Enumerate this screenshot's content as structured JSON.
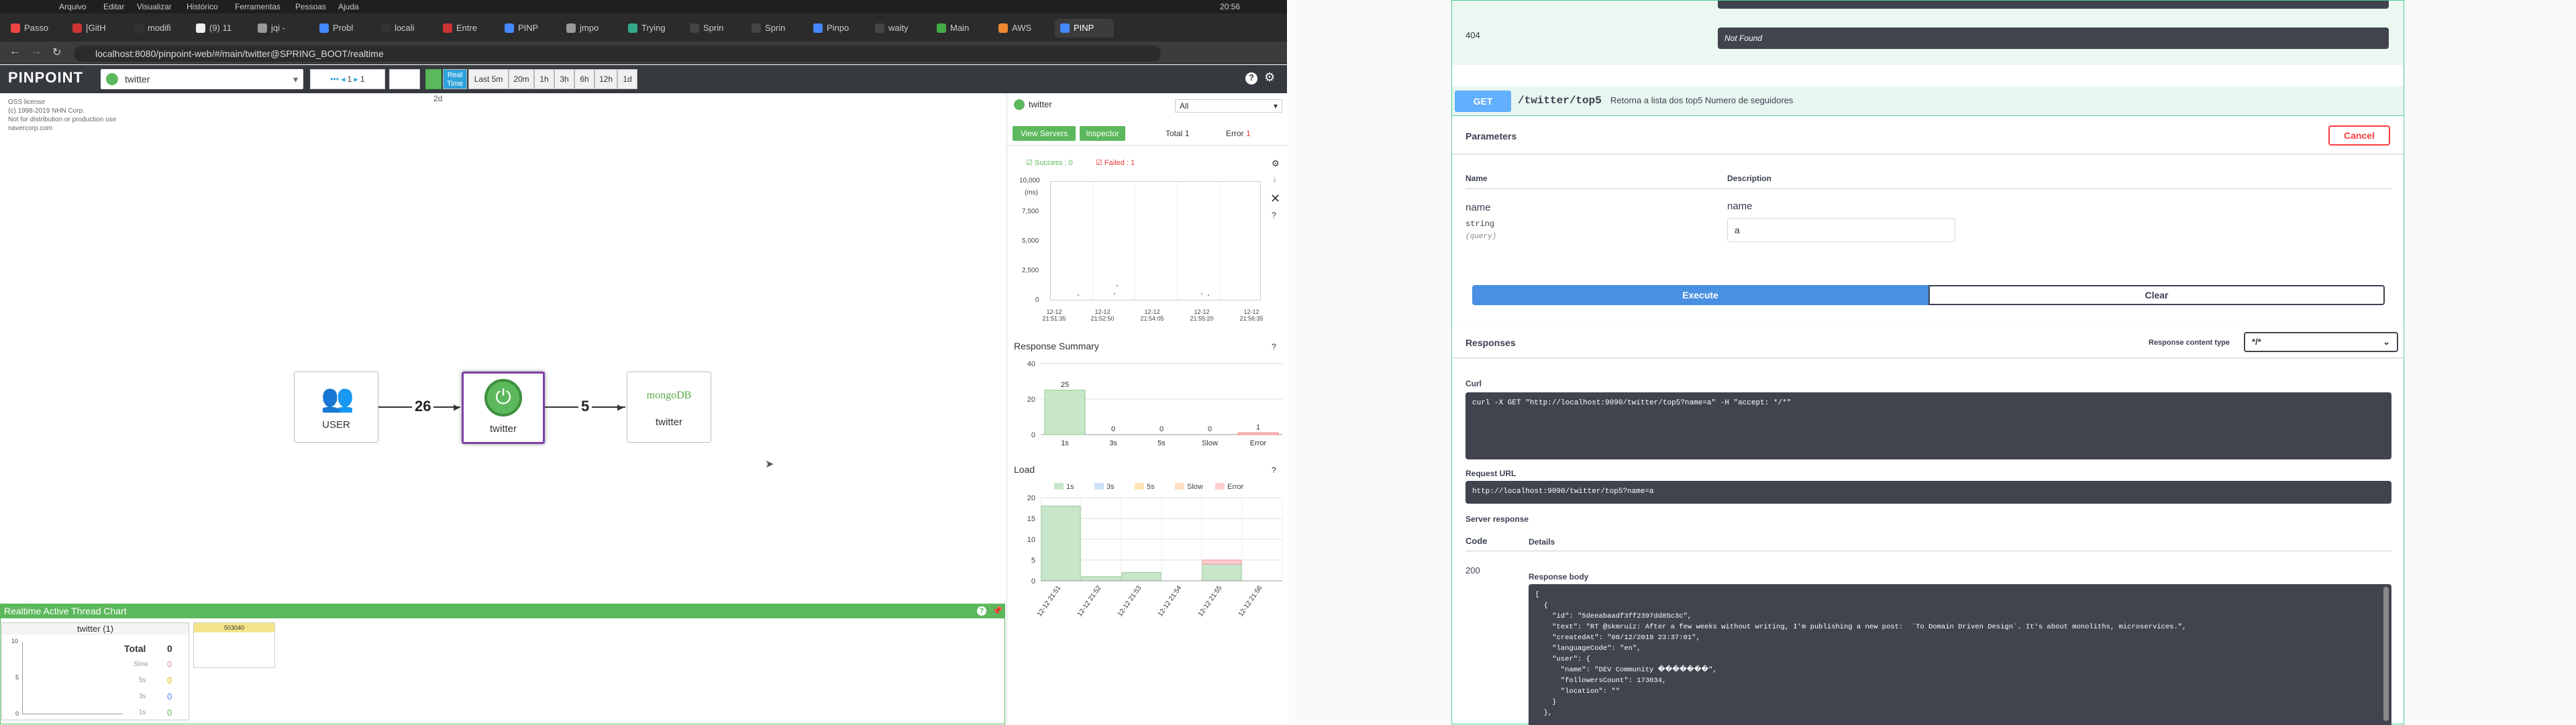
{
  "os": {
    "menu": [
      "Arquivo",
      "Editar",
      "Visualizar",
      "Histórico",
      "Ferramentas",
      "Pessoas",
      "Ajuda"
    ],
    "clock": "20:56"
  },
  "tabs": [
    {
      "label": "Passo",
      "color": "#e44"
    },
    {
      "label": "[GitH",
      "color": "#c33"
    },
    {
      "label": "modifi",
      "color": "#333"
    },
    {
      "label": "(9) 11",
      "color": "#eee"
    },
    {
      "label": "jqi -",
      "color": "#999"
    },
    {
      "label": "Probl",
      "color": "#48f"
    },
    {
      "label": "locali",
      "color": "#333"
    },
    {
      "label": "Entre",
      "color": "#c33"
    },
    {
      "label": "PINP",
      "color": "#48f"
    },
    {
      "label": "jmpo",
      "color": "#999"
    },
    {
      "label": "Trying",
      "color": "#3a8"
    },
    {
      "label": "Sprin",
      "color": "#444"
    },
    {
      "label": "Sprin",
      "color": "#444"
    },
    {
      "label": "Pinpo",
      "color": "#48f"
    },
    {
      "label": "waity",
      "color": "#444"
    },
    {
      "label": "Main",
      "color": "#4a4"
    },
    {
      "label": "AWS",
      "color": "#e83"
    },
    {
      "label": "PINP",
      "color": "#48f",
      "active": true
    }
  ],
  "address": "localhost:8080/pinpoint-web/#/main/twitter@SPRING_BOOT/realtime",
  "header": {
    "logo": "PINPOINT",
    "app": "twitter",
    "arrows1": "1",
    "arrows2": "1",
    "realtime": "Real Time",
    "times": [
      "Last 5m",
      "20m",
      "1h",
      "3h",
      "6h",
      "12h",
      "1d"
    ],
    "sub": "2d"
  },
  "license": [
    "OSS license",
    "(c) 1998-2019 NHN Corp.",
    "Not for distribution or production use",
    "navercorp.com"
  ],
  "servermap": {
    "user": "USER",
    "app": "twitter",
    "db": "twitter",
    "db_logo": "mongoDB",
    "edge1": "26",
    "edge2": "5"
  },
  "rt": {
    "title": "Realtime Active Thread Chart",
    "card": "twitter (1)",
    "total_label": "Total",
    "total": "0",
    "rows": [
      {
        "l": "Slow",
        "v": "0",
        "c": "#e8a"
      },
      {
        "l": "5s",
        "v": "0",
        "c": "#fc0"
      },
      {
        "l": "3s",
        "v": "0",
        "c": "#48f"
      },
      {
        "l": "1s",
        "v": "0",
        "c": "#5b5"
      }
    ],
    "y": [
      "10",
      "5",
      "0"
    ],
    "agent": "503040"
  },
  "info": {
    "app": "twitter",
    "select": "All",
    "view_servers": "View Servers",
    "inspector": "Inspector",
    "total_label": "Total",
    "total": "1",
    "error_label": "Error",
    "error": "1",
    "success": "Success : 0",
    "failed": "Failed : 1",
    "scatter_y": [
      "10,000",
      "(ms)",
      "7,500",
      "5,000",
      "2,500",
      "0"
    ],
    "scatter_x": [
      "12-12\n21:51:35",
      "12-12\n21:52:50",
      "12-12\n21:54:05",
      "12-12\n21:55:20",
      "12-12\n21:56:35"
    ],
    "response_summary": "Response Summary",
    "load": "Load"
  },
  "chart_data": [
    {
      "type": "bar",
      "title": "Response Summary",
      "categories": [
        "1s",
        "3s",
        "5s",
        "Slow",
        "Error"
      ],
      "values": [
        25,
        0,
        0,
        0,
        1
      ],
      "ylim": [
        0,
        40
      ],
      "yticks": [
        0,
        20,
        40
      ]
    },
    {
      "type": "bar",
      "title": "Load",
      "categories": [
        "12-12 21:51",
        "12-12 21:52",
        "12-12 21:53",
        "12-12 21:54",
        "12-12 21:55",
        "12-12 21:56"
      ],
      "series": [
        {
          "name": "1s",
          "values": [
            18,
            1,
            2,
            0,
            4,
            0
          ]
        },
        {
          "name": "Error",
          "values": [
            0,
            0,
            0,
            0,
            1,
            0
          ]
        }
      ],
      "legend": [
        "1s",
        "3s",
        "5s",
        "Slow",
        "Error"
      ],
      "ylim": [
        0,
        20
      ],
      "yticks": [
        0,
        5,
        10,
        15,
        20
      ]
    }
  ],
  "swagger": {
    "code404": "404",
    "not_found": "Not Found",
    "method": "GET",
    "path": "/twitter/top5",
    "desc": "Retorna a lista dos top5 Numero de seguidores",
    "params": "Parameters",
    "cancel": "Cancel",
    "name_h": "Name",
    "desc_h": "Description",
    "p_name": "name",
    "p_type": "string",
    "p_in": "(query)",
    "p_desc": "name",
    "p_value": "a",
    "execute": "Execute",
    "clear": "Clear",
    "responses": "Responses",
    "ctype_label": "Response content type",
    "ctype": "*/*",
    "curl_label": "Curl",
    "curl": "curl -X GET \"http://localhost:9090/twitter/top5?name=a\" -H \"accept: */*\"",
    "req_label": "Request URL",
    "req_url": "http://localhost:9090/twitter/top5?name=a",
    "server_resp": "Server response",
    "code_h": "Code",
    "details_h": "Details",
    "code": "200",
    "body_label": "Response body",
    "body": [
      "[",
      "  {",
      "    \"id\": \"5deeabaadf3ff2397dd85c3c\",",
      "    \"text\": \"RT @skmruiz: After a few weeks without writing, I'm publishing a new post:  `To Domain Driven Design`. It's about monoliths, microservices.\",",
      "    \"createdAt\": \"08/12/2019 23:37:01\",",
      "    \"languageCode\": \"en\",",
      "    \"user\": {",
      "      \"name\": \"DEV Community �������\",",
      "      \"followersCount\": 173034,",
      "      \"location\": \"\"",
      "    }",
      "  },"
    ]
  }
}
